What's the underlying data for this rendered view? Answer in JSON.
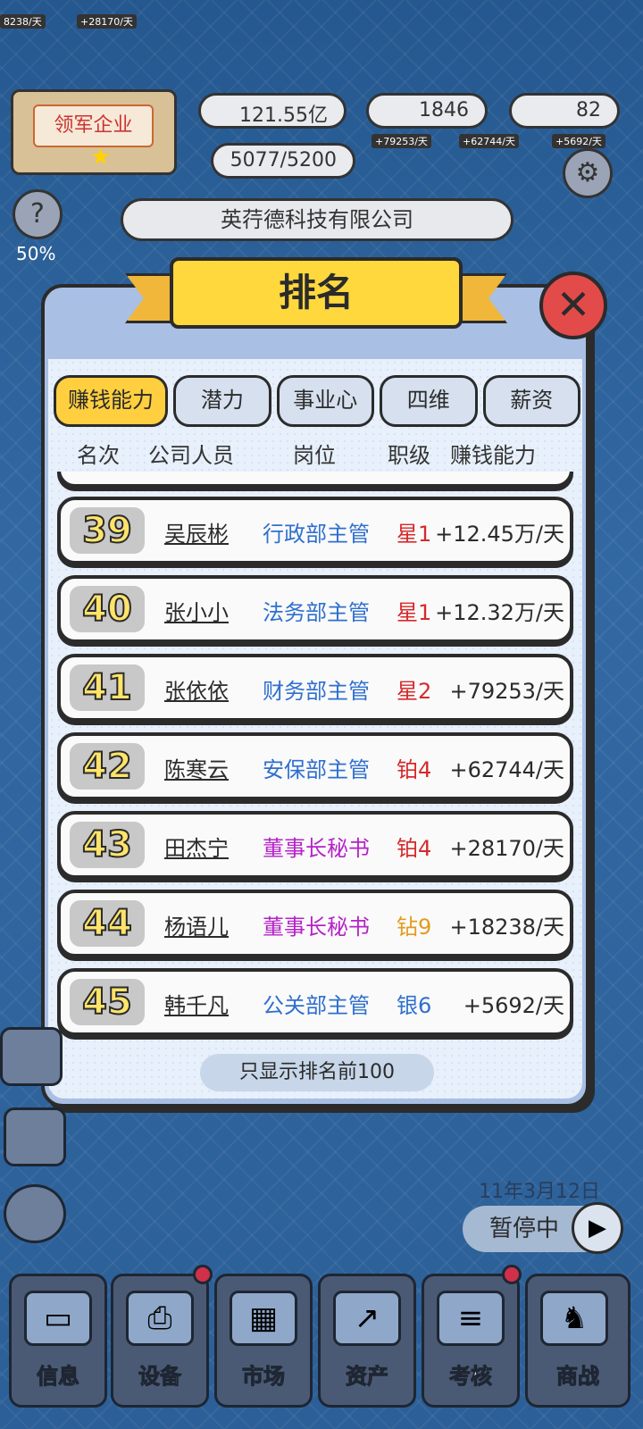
{
  "hud": {
    "money": "121.55亿",
    "gems": "1846",
    "gold": "82",
    "stamina": "5077/5200",
    "help_percent": "50%",
    "top_left_income": "8238/天",
    "top_mid_income": "+28170/天",
    "income_1": "+79253/天",
    "income_2": "+62744/天",
    "income_3": "+5692/天"
  },
  "company": {
    "badge_label": "领军企业",
    "name": "英荇德科技有限公司"
  },
  "modal": {
    "title": "排名",
    "tabs": [
      "赚钱能力",
      "潜力",
      "事业心",
      "四维",
      "薪资"
    ],
    "columns": {
      "rank": "名次",
      "person": "公司人员",
      "position": "岗位",
      "level": "职级",
      "earning": "赚钱能力"
    },
    "rows": [
      {
        "rank": "39",
        "name": "吴辰彬",
        "position": "行政部主管",
        "level": "星1",
        "earning": "+12.45万/天"
      },
      {
        "rank": "40",
        "name": "张小小",
        "position": "法务部主管",
        "level": "星1",
        "earning": "+12.32万/天"
      },
      {
        "rank": "41",
        "name": "张依依",
        "position": "财务部主管",
        "level": "星2",
        "earning": "+79253/天"
      },
      {
        "rank": "42",
        "name": "陈寒云",
        "position": "安保部主管",
        "level": "铂4",
        "earning": "+62744/天"
      },
      {
        "rank": "43",
        "name": "田杰宁",
        "position": "董事长秘书",
        "level": "铂4",
        "earning": "+28170/天"
      },
      {
        "rank": "44",
        "name": "杨语儿",
        "position": "董事长秘书",
        "level": "钻9",
        "earning": "+18238/天"
      },
      {
        "rank": "45",
        "name": "韩千凡",
        "position": "公关部主管",
        "level": "银6",
        "earning": "+5692/天"
      }
    ],
    "footer": "只显示排名前100"
  },
  "status": {
    "date": "11年3月12日",
    "pause_label": "暂停中"
  },
  "nav": [
    "信息",
    "设备",
    "市场",
    "资产",
    "考核",
    "商战"
  ],
  "colors": {
    "blue_position": "#2f6fcf",
    "purple_position": "#b522c9",
    "red_level": "#d6292b",
    "orange_level": "#e29b1c",
    "blue_level": "#2f6fcf"
  }
}
